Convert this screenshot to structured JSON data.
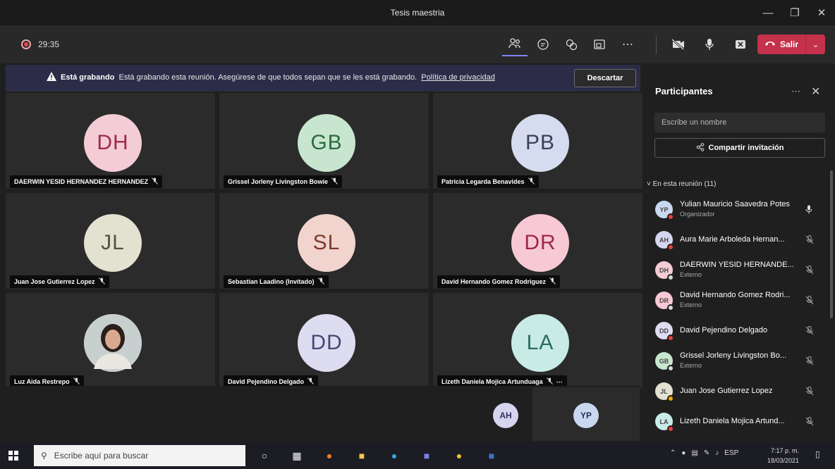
{
  "window": {
    "title": "Tesis maestria"
  },
  "toolbar": {
    "timer": "29:35",
    "leave_label": "Salir"
  },
  "banner": {
    "title": "Está grabando",
    "message": "Está grabando esta reunión. Asegúrese de que todos sepan que se les está grabando.",
    "link": "Política de privacidad",
    "dismiss_label": "Descartar"
  },
  "tiles": [
    {
      "initials": "DH",
      "name": "DAERWIN YESID HERNANDEZ HERNANDEZ",
      "bg": "#f4ccd6",
      "fg": "#a0284f"
    },
    {
      "initials": "GB",
      "name": "Grissel Jorleny Livingston Bowie",
      "bg": "#c8e6cf",
      "fg": "#2c6b3f"
    },
    {
      "initials": "PB",
      "name": "Patricia Legarda Benavides",
      "bg": "#d5dcef",
      "fg": "#3a3f5a"
    },
    {
      "initials": "JL",
      "name": "Juan Jose Gutierrez Lopez",
      "bg": "#e3e1d0",
      "fg": "#55523c"
    },
    {
      "initials": "SL",
      "name": "Sebastian Laadino (Invitado)",
      "bg": "#f1d4cd",
      "fg": "#7e3b2c"
    },
    {
      "initials": "DR",
      "name": "David Hernando Gomez Rodriguez",
      "bg": "#f7c9d5",
      "fg": "#a3274c"
    },
    {
      "initials": "",
      "name": "Luz Aida Restrepo",
      "bg": "#b7c2c4",
      "fg": "#333"
    },
    {
      "initials": "DD",
      "name": "David Pejendino Delgado",
      "bg": "#dedcf1",
      "fg": "#4a4673"
    },
    {
      "initials": "LA",
      "name": "Lizeth Daniela Mojica Artunduaga",
      "bg": "#c8ebe6",
      "fg": "#2b6b63"
    }
  ],
  "strip": [
    {
      "initials": "AH",
      "bg": "#d6d5f0"
    },
    {
      "initials": "YP",
      "bg": "#c9d8f0"
    }
  ],
  "panel": {
    "title": "Participantes",
    "search_placeholder": "Escribe un nombre",
    "share_label": "Compartir invitación",
    "section_label": "En esta reunión (11)",
    "participants": [
      {
        "initials": "YP",
        "name": "Yulian Mauricio Saavedra Potes",
        "sub": "Organizador",
        "bg": "#c9d8f0",
        "status": "#e8423a",
        "mic": "on"
      },
      {
        "initials": "AH",
        "name": "Aura Marie Arboleda Hernan...",
        "sub": "",
        "bg": "#d6d5f0",
        "status": "#e8423a",
        "mic": "off"
      },
      {
        "initials": "DH",
        "name": "DAERWIN YESID HERNANDE...",
        "sub": "Externo",
        "bg": "#f4ccd6",
        "status": "#d9d9d9",
        "mic": "off"
      },
      {
        "initials": "DR",
        "name": "David Hernando Gomez Rodri...",
        "sub": "Externo",
        "bg": "#f7c9d5",
        "status": "#d9d9d9",
        "mic": "off"
      },
      {
        "initials": "DD",
        "name": "David Pejendino Delgado",
        "sub": "",
        "bg": "#dedcf1",
        "status": "#e8423a",
        "mic": "off"
      },
      {
        "initials": "GB",
        "name": "Grissel Jorleny Livingston Bo...",
        "sub": "Externo",
        "bg": "#c8e6cf",
        "status": "#d9d9d9",
        "mic": "off"
      },
      {
        "initials": "JL",
        "name": "Juan Jose Gutierrez Lopez",
        "sub": "",
        "bg": "#e3e1d0",
        "status": "#f2a900",
        "mic": "off"
      },
      {
        "initials": "LA",
        "name": "Lizeth Daniela Mojica Artund...",
        "sub": "",
        "bg": "#c8ebe6",
        "status": "#e8423a",
        "mic": "off"
      }
    ]
  },
  "taskbar": {
    "search_placeholder": "Escribe aquí para buscar",
    "language": "ESP",
    "time": "7:17 p. m.",
    "date": "18/03/2021"
  }
}
